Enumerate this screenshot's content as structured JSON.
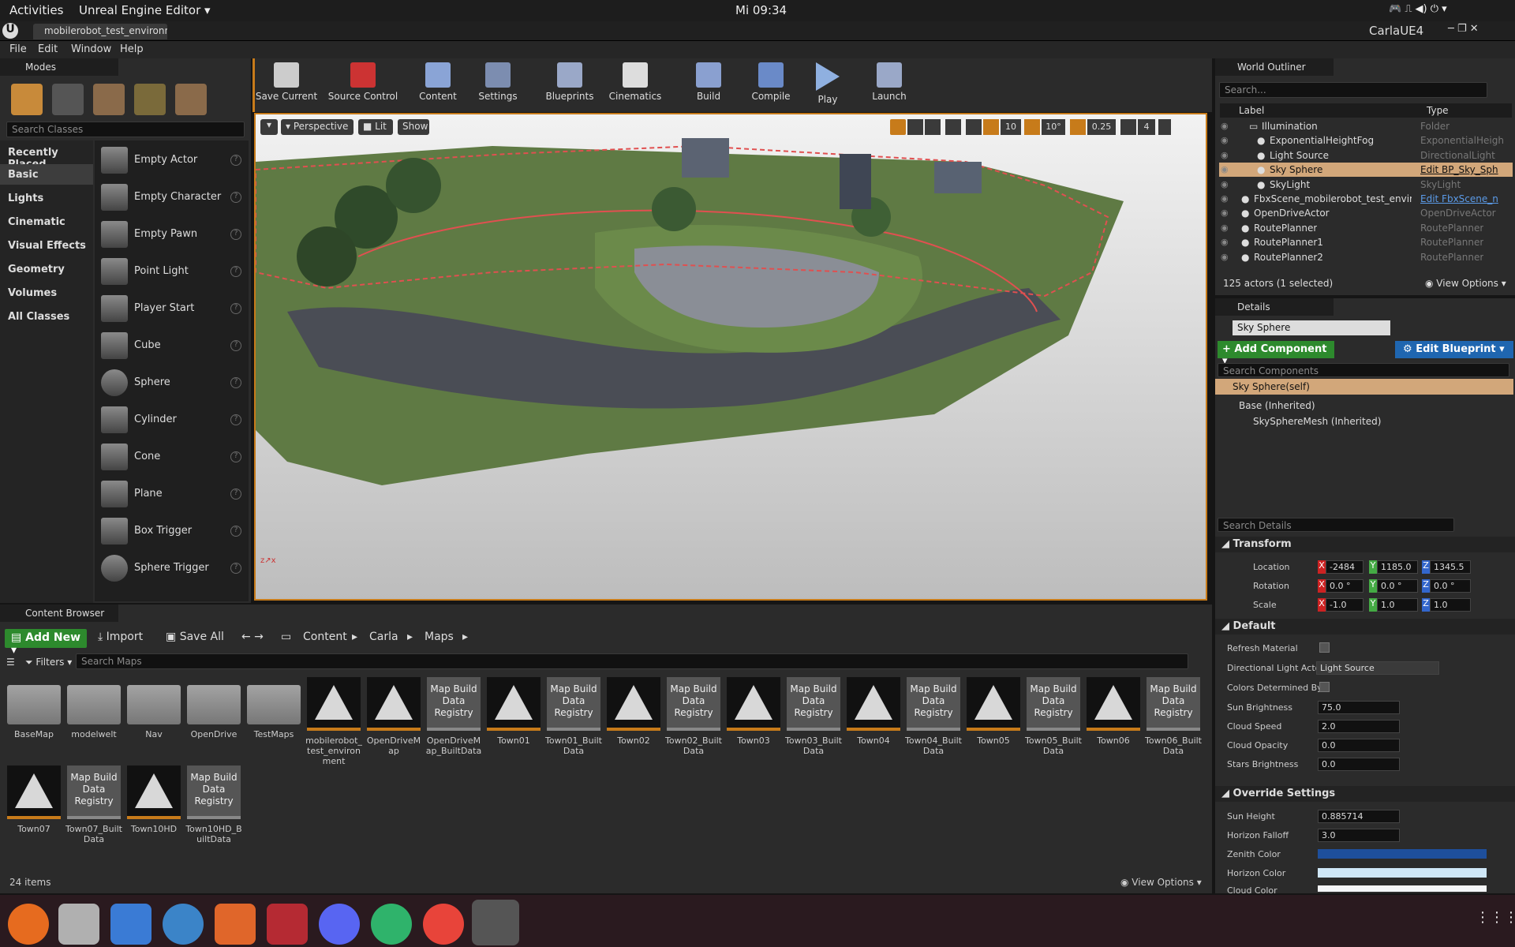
{
  "os_topbar": {
    "activities": "Activities",
    "app": "Unreal Engine Editor",
    "clock": "Mi 09:34"
  },
  "window": {
    "tab_title": "mobilerobot_test_environme",
    "project": "CarlaUE4"
  },
  "menu": {
    "items": [
      "File",
      "Edit",
      "Window",
      "Help"
    ]
  },
  "modes": {
    "tab": "Modes",
    "search_placeholder": "Search Classes",
    "categories": [
      "Recently Placed",
      "Basic",
      "Lights",
      "Cinematic",
      "Visual Effects",
      "Geometry",
      "Volumes",
      "All Classes"
    ],
    "selected_category": "Basic",
    "items": [
      "Empty Actor",
      "Empty Character",
      "Empty Pawn",
      "Point Light",
      "Player Start",
      "Cube",
      "Sphere",
      "Cylinder",
      "Cone",
      "Plane",
      "Box Trigger",
      "Sphere Trigger"
    ],
    "help_glyph": "?"
  },
  "toolbar": {
    "buttons": [
      "Save Current",
      "Source Control",
      "Content",
      "Settings",
      "Blueprints",
      "Cinematics",
      "Build",
      "Compile",
      "Play",
      "Launch"
    ]
  },
  "viewport": {
    "perspective": "Perspective",
    "lit": "Lit",
    "show": "Show",
    "grid_snap": "10",
    "rotation_snap": "10°",
    "scale_snap": "0.25",
    "camera_speed": "4"
  },
  "world_outliner": {
    "tab": "World Outliner",
    "search_placeholder": "Search...",
    "col_label": "Label",
    "col_type": "Type",
    "rows": [
      {
        "label": "Illumination",
        "type": "Folder",
        "indent": 1
      },
      {
        "label": "ExponentialHeightFog",
        "type": "ExponentialHeigh",
        "indent": 2
      },
      {
        "label": "Light Source",
        "type": "DirectionalLight",
        "indent": 2
      },
      {
        "label": "Sky Sphere",
        "type": "Edit BP_Sky_Sph",
        "indent": 2
      },
      {
        "label": "SkyLight",
        "type": "SkyLight",
        "indent": 2
      },
      {
        "label": "FbxScene_mobilerobot_test_enviroi",
        "type": "Edit FbxScene_n",
        "indent": 0
      },
      {
        "label": "OpenDriveActor",
        "type": "OpenDriveActor",
        "indent": 0
      },
      {
        "label": "RoutePlanner",
        "type": "RoutePlanner",
        "indent": 0
      },
      {
        "label": "RoutePlanner1",
        "type": "RoutePlanner",
        "indent": 0
      },
      {
        "label": "RoutePlanner2",
        "type": "RoutePlanner",
        "indent": 0
      }
    ],
    "status": "125 actors (1 selected)",
    "view_options": "View Options"
  },
  "details": {
    "tab": "Details",
    "name": "Sky Sphere",
    "add_component": "+ Add Component",
    "edit_blueprint": "Edit Blueprint",
    "search_components": "Search Components",
    "self_row": "Sky Sphere(self)",
    "base": "Base (Inherited)",
    "mesh": "SkySphereMesh (Inherited)",
    "search_details": "Search Details",
    "transform": "Transform",
    "location": {
      "label": "Location",
      "x": "-2484",
      "y": "1185.0",
      "z": "1345.5"
    },
    "rotation": {
      "label": "Rotation",
      "x": "0.0 °",
      "y": "0.0 °",
      "z": "0.0 °"
    },
    "scale": {
      "label": "Scale",
      "x": "-1.0",
      "y": "1.0",
      "z": "1.0"
    },
    "default": "Default",
    "refresh_material": "Refresh Material",
    "directional_light_actor": "Directional Light Actor",
    "directional_light_value": "Light Source",
    "colors_determined_by": "Colors Determined By",
    "sun_brightness": {
      "label": "Sun Brightness",
      "value": "75.0"
    },
    "cloud_speed": {
      "label": "Cloud Speed",
      "value": "2.0"
    },
    "cloud_opacity": {
      "label": "Cloud Opacity",
      "value": "0.0"
    },
    "stars_brightness": {
      "label": "Stars Brightness",
      "value": "0.0"
    },
    "override": "Override Settings",
    "sun_height": {
      "label": "Sun Height",
      "value": "0.885714"
    },
    "horizon_falloff": {
      "label": "Horizon Falloff",
      "value": "3.0"
    },
    "zenith_color": {
      "label": "Zenith Color",
      "color": "#1e4f9c"
    },
    "horizon_color": {
      "label": "Horizon Color",
      "color": "#cfe7f7"
    },
    "cloud_color": {
      "label": "Cloud Color",
      "color": "#f4f6f8"
    }
  },
  "content_browser": {
    "tab": "Content Browser",
    "add_new": "Add New",
    "import": "Import",
    "save_all": "Save All",
    "path": [
      "Content",
      "Carla",
      "Maps"
    ],
    "filters": "Filters",
    "search_placeholder": "Search Maps",
    "item_count": "24 items",
    "view_options": "View Options",
    "registry_text": "Map Build Data Registry",
    "assets": [
      {
        "name": "BaseMap",
        "kind": "folder"
      },
      {
        "name": "modelwelt",
        "kind": "folder"
      },
      {
        "name": "Nav",
        "kind": "folder"
      },
      {
        "name": "OpenDrive",
        "kind": "folder"
      },
      {
        "name": "TestMaps",
        "kind": "folder"
      },
      {
        "name": "mobilerobot_test_environment",
        "kind": "map"
      },
      {
        "name": "OpenDriveMap",
        "kind": "map"
      },
      {
        "name": "OpenDriveMap_BuiltData",
        "kind": "registry"
      },
      {
        "name": "Town01",
        "kind": "map"
      },
      {
        "name": "Town01_BuiltData",
        "kind": "registry"
      },
      {
        "name": "Town02",
        "kind": "map"
      },
      {
        "name": "Town02_BuiltData",
        "kind": "registry"
      },
      {
        "name": "Town03",
        "kind": "map"
      },
      {
        "name": "Town03_BuiltData",
        "kind": "registry"
      },
      {
        "name": "Town04",
        "kind": "map"
      },
      {
        "name": "Town04_BuiltData",
        "kind": "registry"
      },
      {
        "name": "Town05",
        "kind": "map"
      },
      {
        "name": "Town05_BuiltData",
        "kind": "registry"
      },
      {
        "name": "Town06",
        "kind": "map"
      },
      {
        "name": "Town06_BuiltData",
        "kind": "registry"
      },
      {
        "name": "Town07",
        "kind": "map"
      },
      {
        "name": "Town07_BuiltData",
        "kind": "registry"
      },
      {
        "name": "Town10HD",
        "kind": "map"
      },
      {
        "name": "Town10HD_BuiltData",
        "kind": "registry"
      }
    ]
  },
  "dock": {
    "apps": [
      "firefox-icon",
      "files-icon",
      "writer-icon",
      "help-icon",
      "software-icon",
      "terminal-icon",
      "discord-icon",
      "atom-icon",
      "chrome-icon",
      "unreal-icon"
    ]
  },
  "colors": {
    "accent_orange": "#c77b1a",
    "selected_row": "#d2a77a",
    "green_button": "#2d8a2d",
    "blue_button": "#1f66b0"
  }
}
